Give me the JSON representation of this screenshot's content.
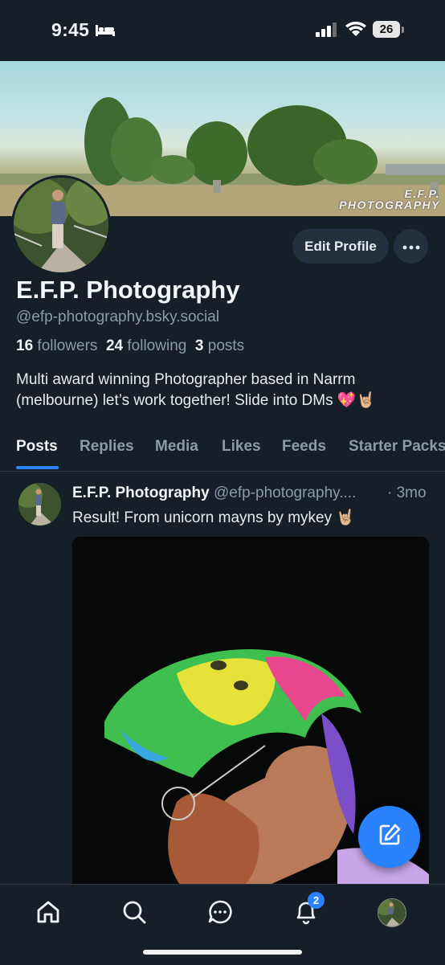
{
  "status": {
    "time": "9:45",
    "battery": "26"
  },
  "banner": {
    "watermark_line1": "E.F.P.",
    "watermark_line2": "PHOTOGRAPHY"
  },
  "profile": {
    "edit_label": "Edit Profile",
    "name": "E.F.P. Photography",
    "handle": "@efp-photography.bsky.social",
    "followers_count": "16",
    "followers_label": "followers",
    "following_count": "24",
    "following_label": "following",
    "posts_count": "3",
    "posts_label": "posts",
    "bio_line1": "Multi award winning Photographer based in Narrm",
    "bio_line2": "(melbourne) let’s work together! Slide into DMs 💖🤘🏼"
  },
  "tabs": [
    "Posts",
    "Replies",
    "Media",
    "Likes",
    "Feeds",
    "Starter Packs"
  ],
  "post": {
    "author": "E.F.P. Photography",
    "handle": "@efp-photography....",
    "time": "· 3mo",
    "text": "Result! From unicorn mayns by mykey 🤘🏼"
  },
  "nav": {
    "notification_badge": "2"
  },
  "colors": {
    "accent": "#2a82ff",
    "background": "#161e27",
    "muted": "#8d9aa8"
  },
  "icons": [
    "bed-icon",
    "signal-icon",
    "wifi-icon",
    "more-icon",
    "compose-icon",
    "home-icon",
    "search-icon",
    "chat-icon",
    "bell-icon"
  ]
}
